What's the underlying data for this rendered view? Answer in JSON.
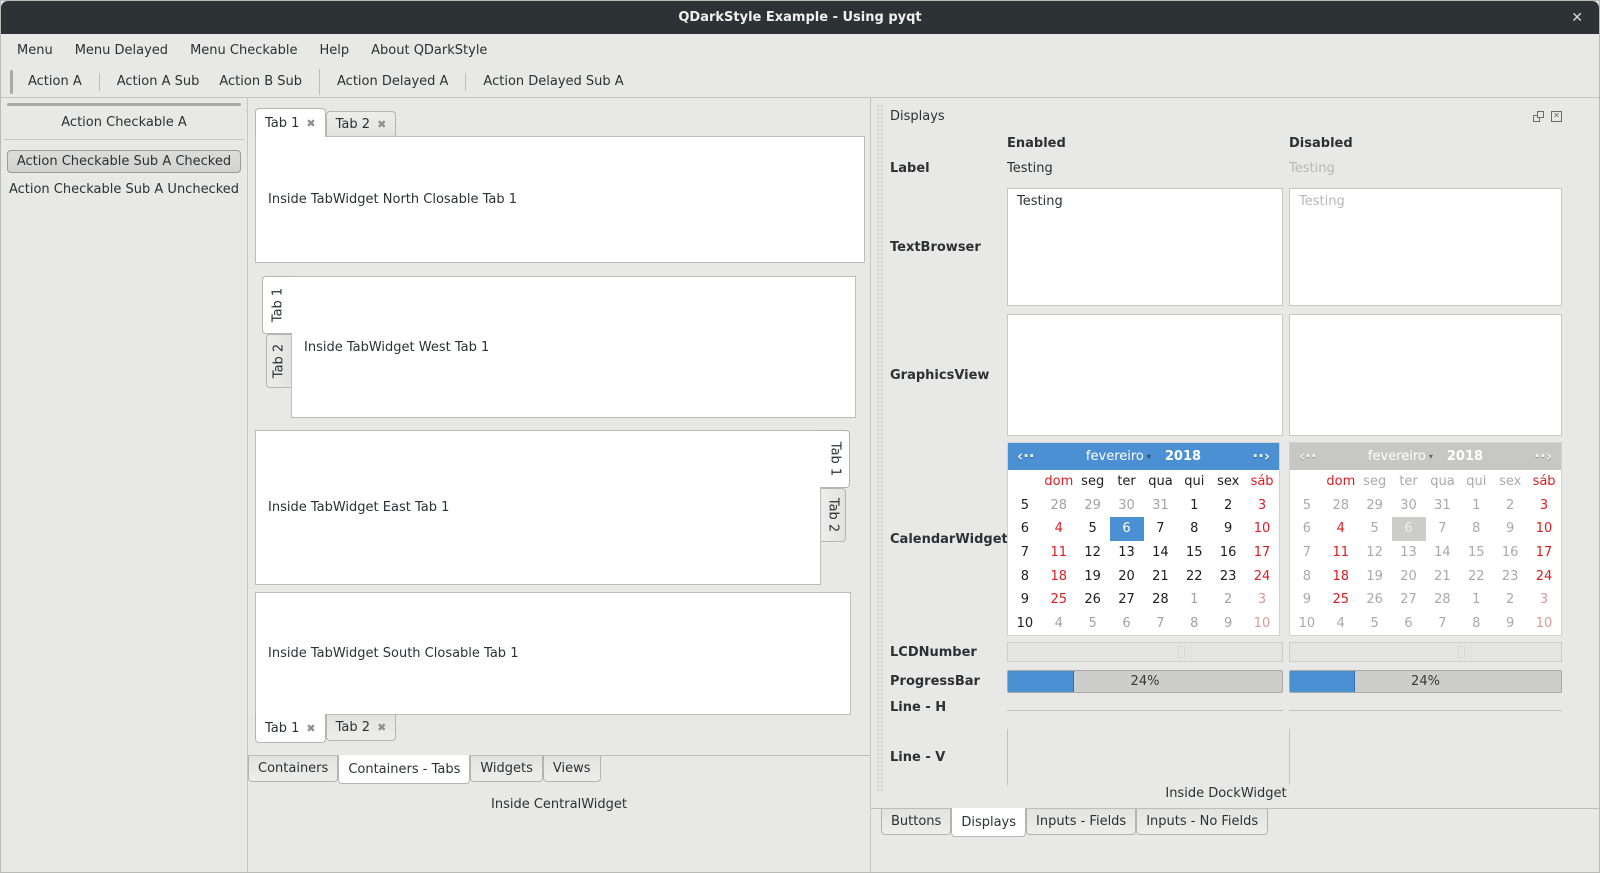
{
  "window": {
    "title": "QDarkStyle Example - Using pyqt",
    "close_glyph": "✕"
  },
  "menubar": {
    "items": [
      "Menu",
      "Menu Delayed",
      "Menu Checkable",
      "Help",
      "About QDarkStyle"
    ]
  },
  "toolbar": {
    "items": [
      "Action A",
      "Action A Sub",
      "Action B Sub",
      "Action Delayed A",
      "Action Delayed Sub A"
    ]
  },
  "left_toolbar": {
    "title": "Action Checkable A",
    "checked_button": "Action Checkable Sub A Checked",
    "unchecked_button": "Action Checkable Sub A Unchecked"
  },
  "central": {
    "north": {
      "tabs": [
        "Tab 1",
        "Tab 2"
      ],
      "close_glyph": "✖",
      "content": "Inside TabWidget North Closable Tab 1"
    },
    "west": {
      "tabs": [
        "Tab 1",
        "Tab 2"
      ],
      "content": "Inside TabWidget West Tab 1"
    },
    "east": {
      "tabs": [
        "Tab 1",
        "Tab 2"
      ],
      "content": "Inside TabWidget East Tab 1"
    },
    "south": {
      "tabs": [
        "Tab 1",
        "Tab 2"
      ],
      "close_glyph": "✖",
      "content": "Inside TabWidget South Closable Tab 1"
    },
    "bottom_tabs": {
      "items": [
        "Containers",
        "Containers - Tabs",
        "Widgets",
        "Views"
      ],
      "selected": "Containers - Tabs"
    },
    "footer": "Inside CentralWidget"
  },
  "dock": {
    "title": "Displays",
    "columns": [
      "Enabled",
      "Disabled"
    ],
    "rows": [
      "Label",
      "TextBrowser",
      "GraphicsView",
      "CalendarWidget",
      "LCDNumber",
      "ProgressBar",
      "Line - H",
      "Line - V"
    ],
    "label_value_enabled": "Testing",
    "label_value_disabled": "Testing",
    "textbrowser_value_enabled": "Testing",
    "textbrowser_value_disabled": "Testing",
    "progress_value": "24%",
    "footer": "Inside DockWidget",
    "bottom_tabs": {
      "items": [
        "Buttons",
        "Displays",
        "Inputs - Fields",
        "Inputs - No Fields"
      ],
      "selected": "Displays"
    }
  },
  "calendar": {
    "month": "fevereiro",
    "year": "2018",
    "prev_glyph": "‹··",
    "next_glyph": "··›",
    "dropdown_glyph": "▾",
    "day_headers": [
      "dom",
      "seg",
      "ter",
      "qua",
      "qui",
      "sex",
      "sáb"
    ],
    "week_numbers": [
      "5",
      "6",
      "7",
      "8",
      "9",
      "10"
    ],
    "selected_day": "6",
    "grid": [
      [
        [
          "28",
          "out"
        ],
        [
          "29",
          "out"
        ],
        [
          "30",
          "out"
        ],
        [
          "31",
          "out"
        ],
        [
          "1",
          "day"
        ],
        [
          "2",
          "day"
        ],
        [
          "3",
          "red"
        ]
      ],
      [
        [
          "4",
          "red"
        ],
        [
          "5",
          "day"
        ],
        [
          "6",
          "sel"
        ],
        [
          "7",
          "day"
        ],
        [
          "8",
          "day"
        ],
        [
          "9",
          "day"
        ],
        [
          "10",
          "red"
        ]
      ],
      [
        [
          "11",
          "red"
        ],
        [
          "12",
          "day"
        ],
        [
          "13",
          "day"
        ],
        [
          "14",
          "day"
        ],
        [
          "15",
          "day"
        ],
        [
          "16",
          "day"
        ],
        [
          "17",
          "red"
        ]
      ],
      [
        [
          "18",
          "red"
        ],
        [
          "19",
          "day"
        ],
        [
          "20",
          "day"
        ],
        [
          "21",
          "day"
        ],
        [
          "22",
          "day"
        ],
        [
          "23",
          "day"
        ],
        [
          "24",
          "red"
        ]
      ],
      [
        [
          "25",
          "red"
        ],
        [
          "26",
          "day"
        ],
        [
          "27",
          "day"
        ],
        [
          "28",
          "day"
        ],
        [
          "1",
          "out"
        ],
        [
          "2",
          "out"
        ],
        [
          "3",
          "outred"
        ]
      ],
      [
        [
          "4",
          "out"
        ],
        [
          "5",
          "out"
        ],
        [
          "6",
          "out"
        ],
        [
          "7",
          "out"
        ],
        [
          "8",
          "out"
        ],
        [
          "9",
          "out"
        ],
        [
          "10",
          "outred"
        ]
      ]
    ]
  },
  "colors": {
    "titlebar_bg": "#2d3234",
    "window_bg": "#e8e8e7",
    "accent_blue": "#4a90d2",
    "weekend_red": "#dd1d22",
    "disabled_text": "#b7b7b6"
  }
}
